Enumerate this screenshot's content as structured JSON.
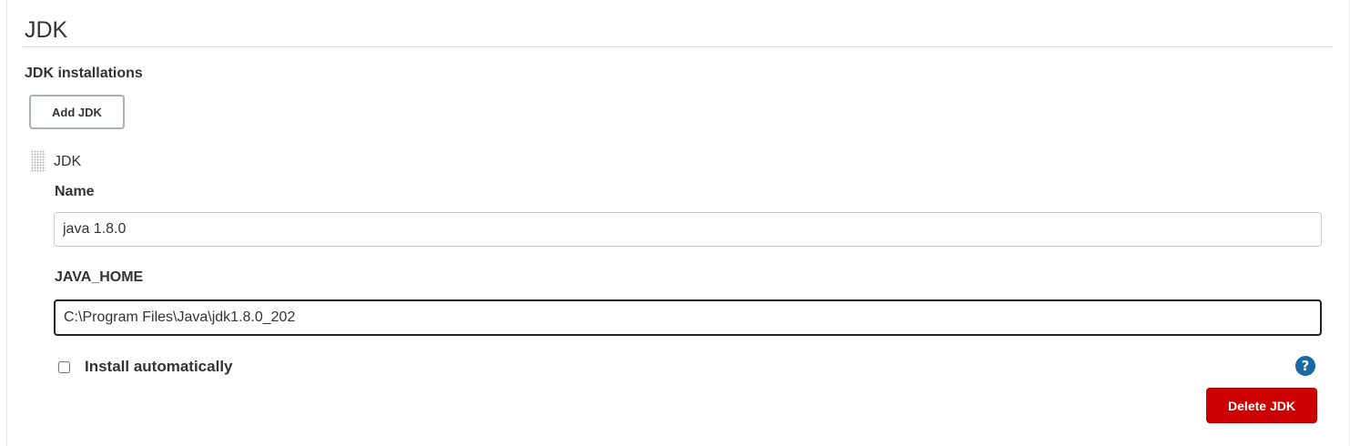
{
  "section": {
    "title": "JDK",
    "installations_label": "JDK installations",
    "add_button_label": "Add JDK"
  },
  "jdk_entry": {
    "title": "JDK",
    "name_label": "Name",
    "name_value": "java 1.8.0",
    "java_home_label": "JAVA_HOME",
    "java_home_value": "C:\\Program Files\\Java\\jdk1.8.0_202",
    "install_automatically_label": "Install automatically",
    "install_automatically_checked": false,
    "help_icon": "question-mark-icon",
    "help_glyph": "?",
    "delete_button_label": "Delete JDK"
  },
  "colors": {
    "delete_button": "#cc0000",
    "help_icon": "#1769a8",
    "focused_input_border": "#222222"
  }
}
